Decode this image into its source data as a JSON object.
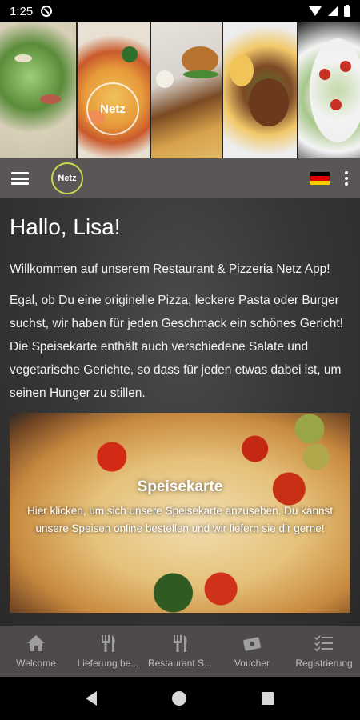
{
  "status_bar": {
    "time": "1:25",
    "icons": [
      "do-not-disturb-icon",
      "wifi-icon",
      "signal-icon",
      "battery-icon"
    ]
  },
  "header": {
    "photos": [
      "salad-pizza-photo",
      "pasta-shrimp-photo",
      "burger-fries-photo",
      "steak-fries-photo",
      "salad-bowl-photo"
    ],
    "overlay_logo_text": "Netz"
  },
  "toolbar": {
    "menu_icon": "hamburger-icon",
    "logo_text": "Netz",
    "language_flag": "german-flag",
    "flag_colors": [
      "#000000",
      "#dd0000",
      "#ffce00"
    ],
    "overflow_icon": "more-vert-icon"
  },
  "main": {
    "greeting": "Hallo, Lisa!",
    "welcome": "Willkommen auf unserem Restaurant & Pizzeria Netz App!",
    "description": "Egal, ob Du eine originelle Pizza, leckere Pasta oder Burger suchst, wir haben für jeden Geschmack ein schönes Gericht! Die Speisekarte enthält auch verschiedene Salate und vegetarische Gerichte, so dass für jeden etwas dabei ist, um seinen Hunger zu stillen.",
    "card": {
      "title": "Speisekarte",
      "text": "Hier klicken, um sich unsere Speisekarte anzusehen. Du kannst unsere Speisen online bestellen und wir liefern sie dir gerne!"
    }
  },
  "bottom_nav": {
    "items": [
      {
        "label": "Welcome",
        "icon": "home-icon"
      },
      {
        "label": "Lieferung be...",
        "icon": "cutlery-icon"
      },
      {
        "label": "Restaurant S...",
        "icon": "cutlery-icon"
      },
      {
        "label": "Voucher",
        "icon": "voucher-icon"
      },
      {
        "label": "Registrierung",
        "icon": "checklist-icon"
      }
    ]
  },
  "colors": {
    "toolbar_bg": "#5a5656",
    "bottom_nav_bg": "#4e4a4a",
    "logo_accent": "#c7d84a"
  }
}
